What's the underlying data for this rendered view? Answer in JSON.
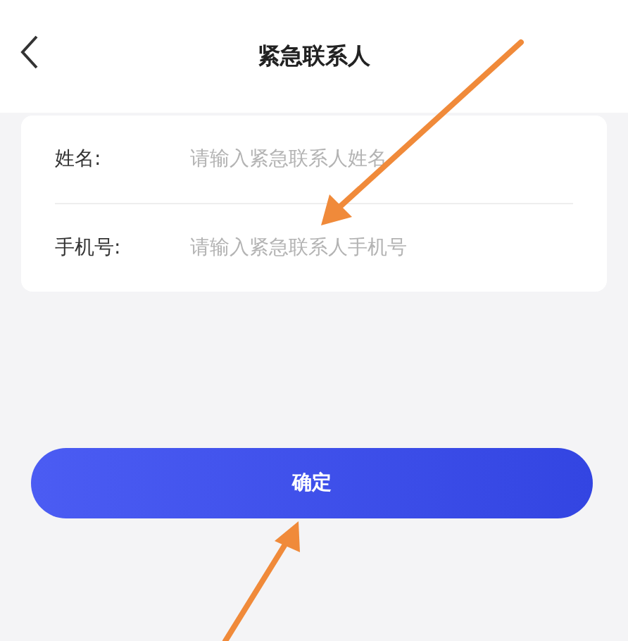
{
  "header": {
    "title": "紧急联系人"
  },
  "form": {
    "fields": [
      {
        "label": "姓名:",
        "placeholder": "请输入紧急联系人姓名"
      },
      {
        "label": "手机号:",
        "placeholder": "请输入紧急联系人手机号"
      }
    ]
  },
  "confirm_button": "确定"
}
